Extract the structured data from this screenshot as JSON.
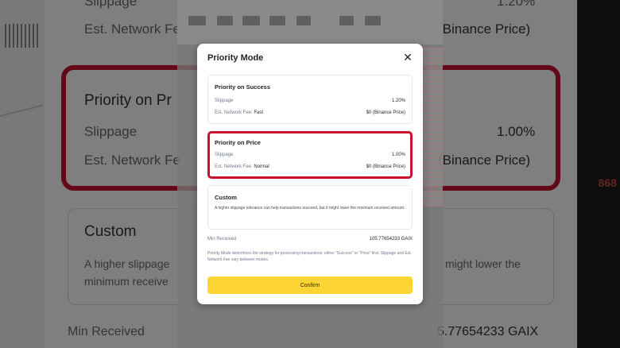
{
  "background": {
    "slippage_label": "Slippage",
    "slippage_value_top": "1.20%",
    "network_fee_label": "Est. Network Fe",
    "binance_price": "(Binance Price)",
    "priority_on_price_label": "Priority on Pr",
    "slippage_value": "1.00%",
    "custom_label": "Custom",
    "custom_desc_start": "A higher slippage",
    "custom_desc_end": "might lower the",
    "custom_desc_line2": "minimum receive",
    "min_received_label": "Min Received",
    "min_received_value": "5.77654233 GAIX",
    "right_number": "868"
  },
  "modal": {
    "title": "Priority Mode",
    "options": [
      {
        "name": "Priority on Success",
        "slippage_label": "Slippage",
        "slippage_value": "1.20%",
        "fee_label": "Est. Network Fee:",
        "fee_level": "Fast",
        "fee_value": "$0 (Binance Price)"
      },
      {
        "name": "Priority on Price",
        "slippage_label": "Slippage",
        "slippage_value": "1.00%",
        "fee_label": "Est. Network Fee:",
        "fee_level": "Normal",
        "fee_value": "$0 (Binance Price)"
      },
      {
        "name": "Custom",
        "description": "A higher slippage tolerance can help transactions succeed, but it might lower the minimum received amount."
      }
    ],
    "min_received_label": "Min Received",
    "min_received_value": "105.77654233 GAIX",
    "note": "Priority Mode determines the strategy for processing transactions: either \"Success\" or \"Price\" first. Slippage and Est. Network Fee vary between modes.",
    "confirm_label": "Confirm"
  },
  "colors": {
    "highlight_border": "#c8102e",
    "confirm_bg": "#fcd535"
  },
  "icons": {
    "close": "close-icon",
    "cursor": "mouse-cursor-icon"
  }
}
